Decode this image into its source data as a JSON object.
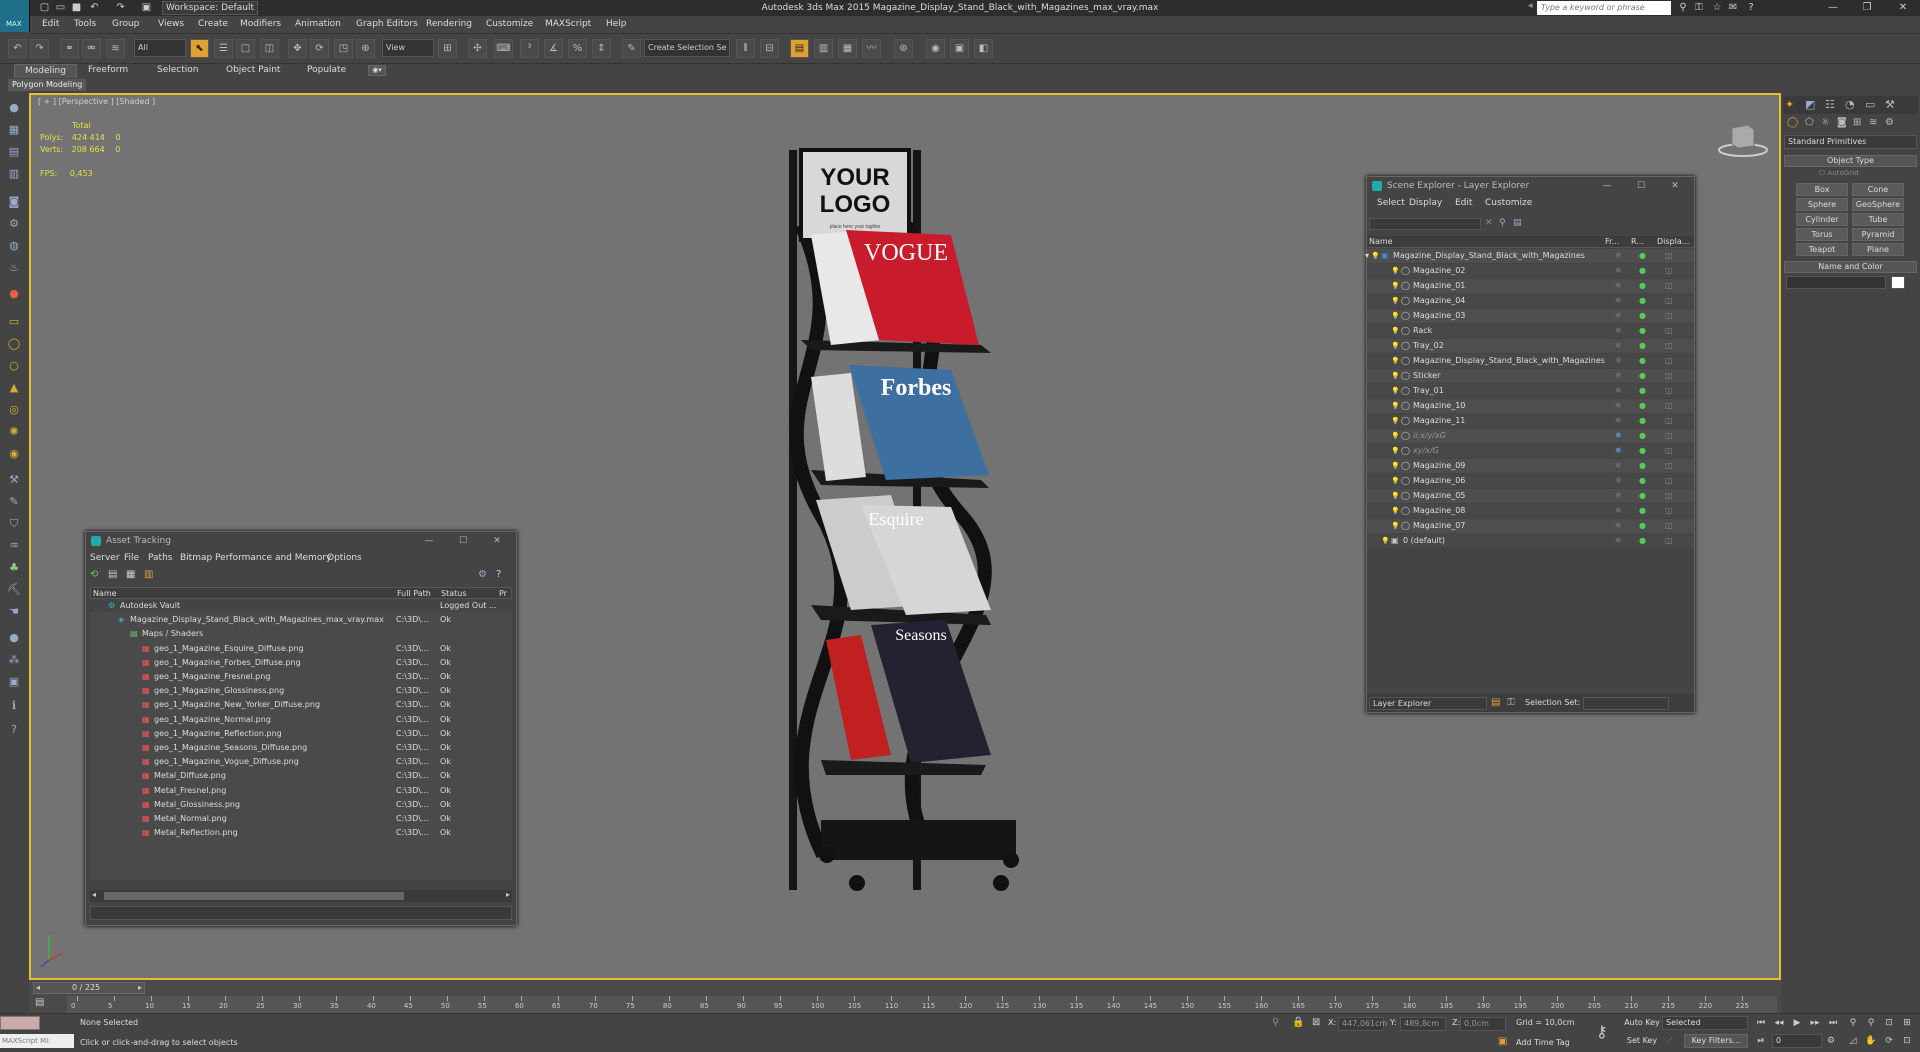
{
  "app": {
    "title": "Autodesk 3ds Max  2015    Magazine_Display_Stand_Black_with_Magazines_max_vray.max",
    "logo_text": "MAX",
    "workspace": "Workspace: Default",
    "search_placeholder": "Type a keyword or phrase"
  },
  "menu": [
    "Edit",
    "Tools",
    "Group",
    "Views",
    "Create",
    "Modifiers",
    "Animation",
    "Graph Editors",
    "Rendering",
    "Customize",
    "MAXScript",
    "Help"
  ],
  "toolbar": {
    "filter": "All",
    "refcoord": "View",
    "named_sel": "Create Selection Se"
  },
  "ribbon": {
    "tabs": [
      "Modeling",
      "Freeform",
      "Selection",
      "Object Paint",
      "Populate"
    ],
    "sub": "Polygon Modeling"
  },
  "viewport": {
    "label": "[ + ] [Perspective ] [Shaded ]",
    "stats": {
      "total": "Total",
      "polys_label": "Polys:",
      "polys": "424 414",
      "polys_sel": "0",
      "verts_label": "Verts:",
      "verts": "208 664",
      "verts_sel": "0",
      "fps_label": "FPS:",
      "fps": "0,453"
    },
    "sign_text": {
      "line1": "YOUR",
      "line2": "LOGO",
      "tagline": "place here your tagline"
    },
    "mag_titles": [
      "VOGUE",
      "Forbes",
      "Esquire",
      "Seasons"
    ]
  },
  "command_panel": {
    "dropdown": "Standard Primitives",
    "object_type": "Object Type",
    "autogrid": "AutoGrid",
    "buttons": [
      "Box",
      "Cone",
      "Sphere",
      "GeoSphere",
      "Cylinder",
      "Tube",
      "Torus",
      "Pyramid",
      "Teapot",
      "Plane"
    ],
    "name_color": "Name and Color"
  },
  "scene_explorer": {
    "title": "Scene Explorer - Layer Explorer",
    "menu": [
      "Select",
      "Display",
      "Edit",
      "Customize"
    ],
    "cols": [
      "Name",
      "Fr...",
      "R...",
      "Displa..."
    ],
    "root": "Magazine_Display_Stand_Black_with_Magazines",
    "items": [
      "Magazine_02",
      "Magazine_01",
      "Magazine_04",
      "Magazine_03",
      "Rack",
      "Tray_02",
      "Magazine_Display_Stand_Black_with_Magazines",
      "Sticker",
      "Tray_01",
      "Magazine_10",
      "Magazine_11",
      "ii;x/y/xG",
      "xy/x/G",
      "Magazine_09",
      "Magazine_06",
      "Magazine_05",
      "Magazine_08",
      "Magazine_07"
    ],
    "default_layer": "0 (default)",
    "footer_left": "Layer Explorer",
    "footer_right": "Selection Set:"
  },
  "asset_tracking": {
    "title": "Asset Tracking",
    "menu": [
      "Server",
      "File",
      "Paths",
      "Bitmap Performance and Memory",
      "Options"
    ],
    "cols": [
      "Name",
      "Full Path",
      "Status",
      "Pr"
    ],
    "vault": {
      "name": "Autodesk Vault",
      "status": "Logged Out ..."
    },
    "file": {
      "name": "Magazine_Display_Stand_Black_with_Magazines_max_vray.max",
      "path": "C:\\3D\\...",
      "status": "Ok"
    },
    "maps_label": "Maps / Shaders",
    "maps": [
      {
        "name": "geo_1_Magazine_Esquire_Diffuse.png",
        "path": "C:\\3D\\...",
        "status": "Ok"
      },
      {
        "name": "geo_1_Magazine_Forbes_Diffuse.png",
        "path": "C:\\3D\\...",
        "status": "Ok"
      },
      {
        "name": "geo_1_Magazine_Fresnel.png",
        "path": "C:\\3D\\...",
        "status": "Ok"
      },
      {
        "name": "geo_1_Magazine_Glossiness.png",
        "path": "C:\\3D\\...",
        "status": "Ok"
      },
      {
        "name": "geo_1_Magazine_New_Yorker_Diffuse.png",
        "path": "C:\\3D\\...",
        "status": "Ok"
      },
      {
        "name": "geo_1_Magazine_Normal.png",
        "path": "C:\\3D\\...",
        "status": "Ok"
      },
      {
        "name": "geo_1_Magazine_Reflection.png",
        "path": "C:\\3D\\...",
        "status": "Ok"
      },
      {
        "name": "geo_1_Magazine_Seasons_Diffuse.png",
        "path": "C:\\3D\\...",
        "status": "Ok"
      },
      {
        "name": "geo_1_Magazine_Vogue_Diffuse.png",
        "path": "C:\\3D\\...",
        "status": "Ok"
      },
      {
        "name": "Metal_Diffuse.png",
        "path": "C:\\3D\\...",
        "status": "Ok"
      },
      {
        "name": "Metal_Fresnel.png",
        "path": "C:\\3D\\...",
        "status": "Ok"
      },
      {
        "name": "Metal_Glossiness.png",
        "path": "C:\\3D\\...",
        "status": "Ok"
      },
      {
        "name": "Metal_Normal.png",
        "path": "C:\\3D\\...",
        "status": "Ok"
      },
      {
        "name": "Metal_Reflection.png",
        "path": "C:\\3D\\...",
        "status": "Ok"
      }
    ]
  },
  "timeline": {
    "frame": "0 / 225",
    "ticks": [
      "0",
      "5",
      "10",
      "15",
      "20",
      "25",
      "30",
      "35",
      "40",
      "45",
      "50",
      "55",
      "60",
      "65",
      "70",
      "75",
      "80",
      "85",
      "90",
      "95",
      "100",
      "105",
      "110",
      "115",
      "120",
      "125",
      "130",
      "135",
      "140",
      "145",
      "150",
      "155",
      "160",
      "165",
      "170",
      "175",
      "180",
      "185",
      "190",
      "195",
      "200",
      "205",
      "210",
      "215",
      "220",
      "225"
    ]
  },
  "status": {
    "maxscript": "MAXScript Mi:",
    "selection": "None Selected",
    "prompt": "Click or click-and-drag to select objects",
    "x_label": "X:",
    "x": "447,061cm",
    "y_label": "Y:",
    "y": "489,8cm",
    "z_label": "Z:",
    "z": "0,0cm",
    "grid": "Grid = 10,0cm",
    "add_time_tag": "Add Time Tag",
    "auto_key": "Auto Key",
    "set_key": "Set Key",
    "selected": "Selected",
    "key_filters": "Key Filters...",
    "frame_num": "0"
  },
  "colors": {
    "viewport_bg": "#737373",
    "viewport_border": "#e4c030",
    "stats": "#e8e040",
    "accent": "#e0a030"
  }
}
